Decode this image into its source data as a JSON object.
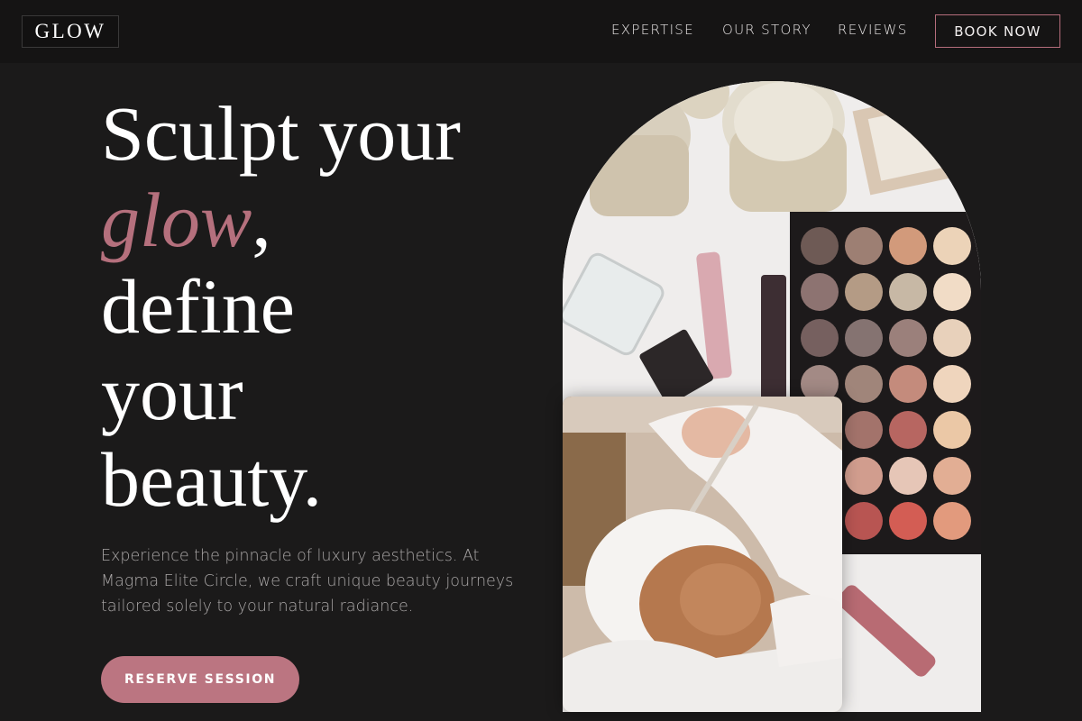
{
  "brand": {
    "logo": "GLOW"
  },
  "nav": {
    "items": [
      {
        "label": "EXPERTISE"
      },
      {
        "label": "OUR STORY"
      },
      {
        "label": "REVIEWS"
      }
    ],
    "book_button": "BOOK NOW"
  },
  "hero": {
    "headline_part1": "Sculpt your",
    "headline_accent": "glow",
    "headline_comma": ",",
    "headline_line3": "define",
    "headline_line4": "your",
    "headline_line5": "beauty.",
    "subtext": "Experience the pinnacle of luxury aesthetics. At Magma Elite Circle, we craft unique beauty journeys tailored solely to your natural radiance.",
    "cta_label": "RESERVE SESSION"
  },
  "colors": {
    "accent": "#b5707d",
    "background": "#1b1a1a",
    "header": "#151414"
  },
  "images": {
    "arch": "makeup-flatlay-photo",
    "card": "facial-treatment-photo"
  }
}
